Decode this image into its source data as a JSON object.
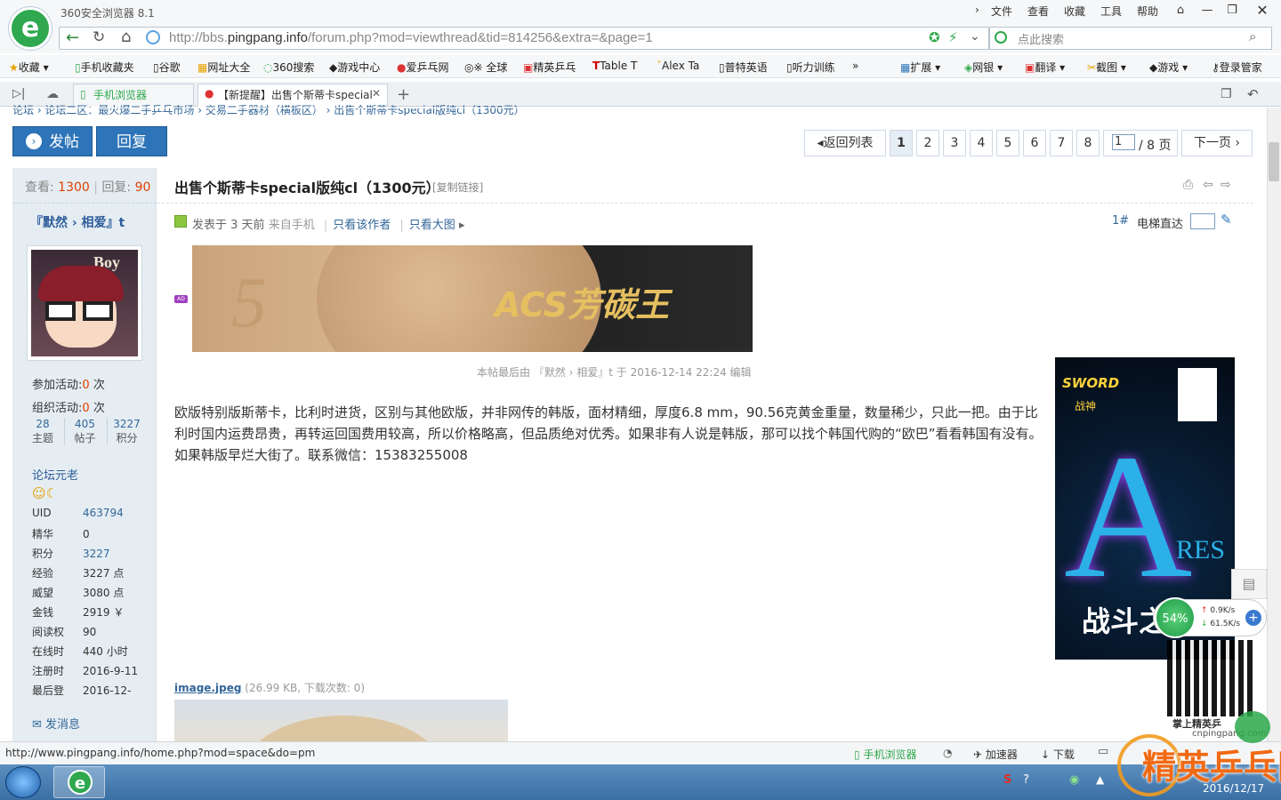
{
  "browser": {
    "app_title": "360安全浏览器 8.1",
    "menu": [
      "文件",
      "查看",
      "收藏",
      "工具",
      "帮助"
    ],
    "url_prefix": "http://bbs.",
    "url_domain": "pingpang.info",
    "url_path": "/forum.php?mod=viewthread&tid=814256&extra=&page=1",
    "search_placeholder": "点此搜索",
    "bookmarks": [
      "收藏",
      "手机收藏夹",
      "谷歌",
      "网址大全",
      "360搜索",
      "游戏中心",
      "爱乒乓网",
      "※ 全球",
      "精英乒乓",
      "Table T",
      "Alex Ta",
      "普特英语",
      "听力训练"
    ],
    "extensions": [
      "扩展",
      "网银",
      "翻译",
      "截图",
      "游戏",
      "登录管家"
    ],
    "tabs": [
      "手机浏览器",
      "【新提醒】出售个斯蒂卡special"
    ],
    "status_url": "http://www.pingpang.info/home.php?mod=space&do=pm",
    "status_items": [
      "手机浏览器",
      "加速器",
      "下载"
    ],
    "net_percent": "54%",
    "net_up": "0.9K/s",
    "net_down": "61.5K/s",
    "taskbar_date": "2016/12/17"
  },
  "breadcrumb": "论坛 › 论坛二区：最火爆二手乒乓市场 › 交易二手器材（横板区） › 出售个斯蒂卡special版纯cl（1300元）",
  "actions": {
    "post": "发帖",
    "reply": "回复"
  },
  "pagination": {
    "back": "返回列表",
    "pages": [
      "1",
      "2",
      "3",
      "4",
      "5",
      "6",
      "7",
      "8"
    ],
    "input": "1",
    "total": "/ 8 页",
    "next": "下一页"
  },
  "stats": {
    "views_label": "查看:",
    "views": "1300",
    "replies_label": "回复:",
    "replies": "90"
  },
  "thread": {
    "title": "出售个斯蒂卡special版纯cl（1300元）",
    "copy_link": "[复制链接]",
    "posted": "发表于 3 天前",
    "from_mobile": "来自手机",
    "only_author": "只看该作者",
    "only_big": "只看大图",
    "floor": "1#",
    "elevator": "电梯直达",
    "ad_text": "ACS芳碳王",
    "edited": "本帖最后由 『默然 › 相爱』t 于 2016-12-14 22:24 编辑",
    "body": "欧版特别版斯蒂卡，比利时进货，区别与其他欧版，并非网传的韩版，面材精细，厚度6.8 mm，90.56克黄金重量，数量稀少，只此一把。由于比利时国内运费昂贵，再转运回国费用较高，所以价格略高，但品质绝对优秀。如果非有人说是韩版，那可以找个韩国代购的“欧巴”看看韩国有没有。如果韩版早烂大街了。联系微信：15383255008",
    "attachment_name": "image.jpeg",
    "attachment_meta": "(26.99 KB, 下载次数: 0)"
  },
  "side_ad": {
    "brand": "SWORD",
    "sub": "战神",
    "big": "A",
    "res": "RES",
    "slogan": "战斗之"
  },
  "watermark": {
    "site": "cnpingpang.com",
    "name": "精英乒乓网",
    "small": "掌上精英乒"
  },
  "user": {
    "name": "『默然 › 相爱』t",
    "avatar_text": "Boy",
    "activity_join_label": "参加活动:",
    "activity_join": "0",
    "activity_join_unit": "次",
    "activity_org_label": "组织活动:",
    "activity_org": "0",
    "activity_org_unit": "次",
    "counts": [
      {
        "v": "28",
        "l": "主题"
      },
      {
        "v": "405",
        "l": "帖子"
      },
      {
        "v": "3227",
        "l": "积分"
      }
    ],
    "rank": "论坛元老",
    "info": [
      {
        "k": "UID",
        "v": "463794"
      },
      {
        "k": "精华",
        "v": "0"
      },
      {
        "k": "积分",
        "v": "3227"
      },
      {
        "k": "经验",
        "v": "3227 点"
      },
      {
        "k": "威望",
        "v": "3080 点"
      },
      {
        "k": "金钱",
        "v": "2919 ￥"
      },
      {
        "k": "阅读权",
        "v": "90"
      },
      {
        "k": "在线时",
        "v": "440 小时"
      },
      {
        "k": "注册时",
        "v": "2016-9-11"
      },
      {
        "k": "最后登",
        "v": "2016-12-"
      }
    ],
    "send_msg": "发消息"
  }
}
